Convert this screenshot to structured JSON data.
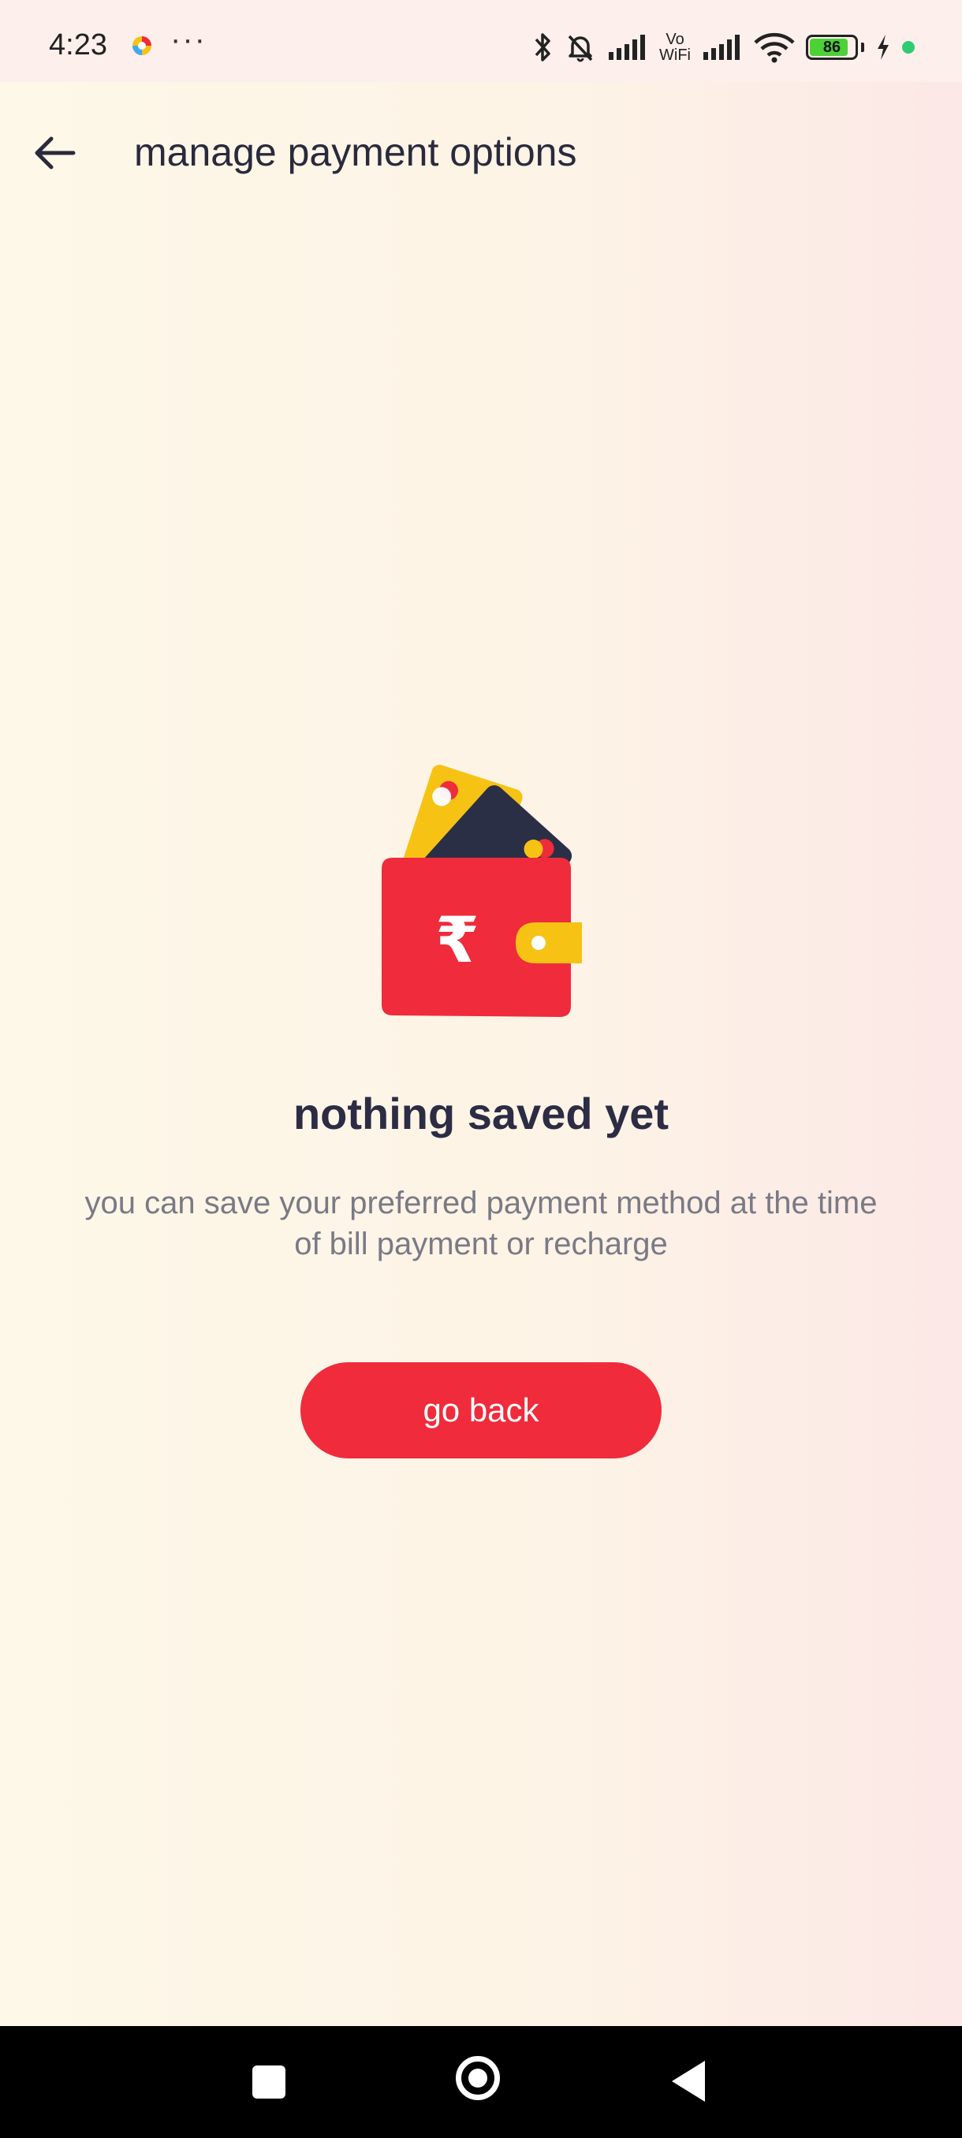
{
  "status_bar": {
    "time": "4:23",
    "more": "···",
    "icons": [
      "bluetooth-icon",
      "mute-icon",
      "signal-icon",
      "vowifi-icon",
      "signal-icon",
      "wifi-icon",
      "battery-icon",
      "charging-icon"
    ],
    "vowifi_top": "Vo",
    "vowifi_bottom": "WiFi",
    "battery_percent": "86",
    "battery_level": 0.86
  },
  "header": {
    "back_icon": "arrow-left-icon",
    "title": "manage payment options"
  },
  "empty_state": {
    "illustration": "wallet-with-cards-icon",
    "currency_symbol": "₹",
    "title": "nothing saved yet",
    "description": "you can save your preferred payment method at the time of bill payment or recharge",
    "button_label": "go back"
  },
  "colors": {
    "accent": "#ef2b3c",
    "card_yellow": "#f6c214",
    "card_navy": "#2b2f45",
    "title_text": "#2c2c44",
    "desc_text": "#7a7a86"
  },
  "nav_bar": {
    "icons": [
      "recent-apps-icon",
      "home-icon",
      "back-icon"
    ]
  }
}
